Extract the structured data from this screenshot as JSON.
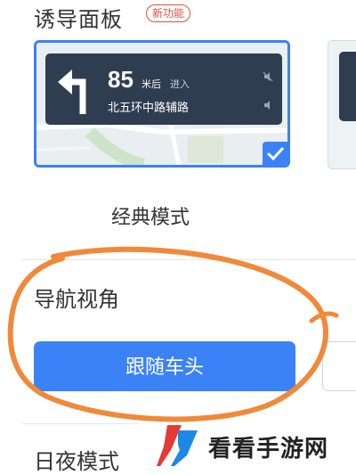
{
  "guidance": {
    "title": "诱导面板",
    "badge": "新功能",
    "card": {
      "distance": "85",
      "unit": "米后",
      "enter": "进入",
      "road": "北五环中路辅路",
      "turn_icon": "turn-left-arrow-icon",
      "selected": true
    },
    "mode_label": "经典模式"
  },
  "view": {
    "title": "导航视角",
    "follow_button": "跟随车头"
  },
  "night": {
    "title": "日夜模式"
  },
  "watermark": {
    "text": "看看手游网"
  },
  "colors": {
    "accent": "#3b82f6",
    "badge": "#e74c3c",
    "annotation": "#f0893a",
    "panel": "#2f3d51"
  }
}
